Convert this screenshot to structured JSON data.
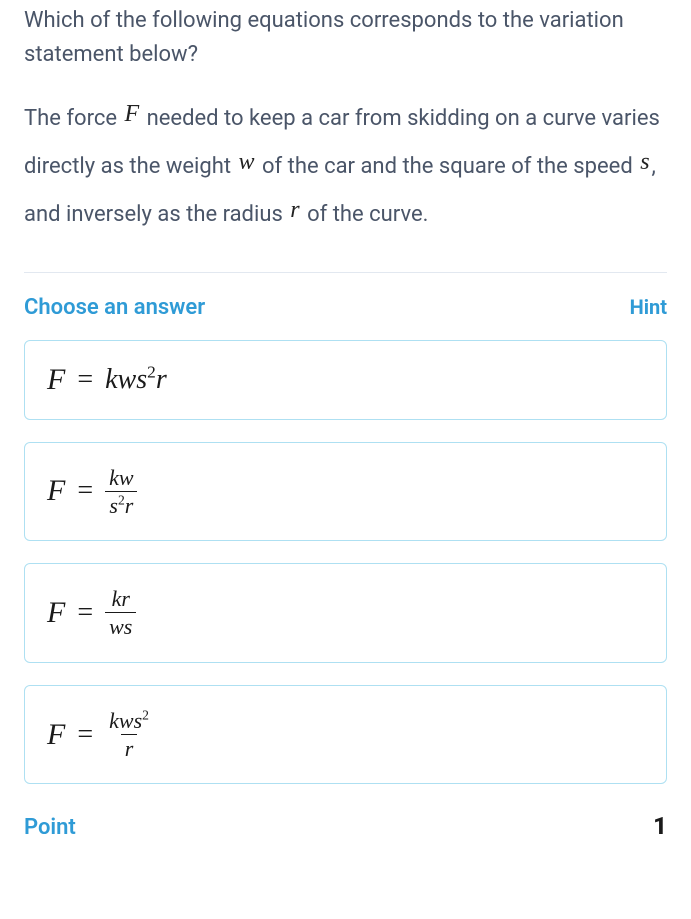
{
  "question": "Which of the following equations corresponds to the variation statement below?",
  "statement": {
    "p1a": "The force ",
    "var_F": "F",
    "p1b": " needed to keep a car from skidding on a curve varies directly as the weight ",
    "var_w": "w",
    "p1c": " of the car and the square of the speed ",
    "var_s": "s",
    "p1d": ", and inversely as the radius ",
    "var_r": "r",
    "p1e": " of the curve."
  },
  "choose_label": "Choose an answer",
  "hint_label": "Hint",
  "answers": {
    "a": {
      "lhs": "F",
      "eq": "=",
      "rhs": "kws",
      "rhs_exp": "2",
      "rhs_tail": "r"
    },
    "b": {
      "lhs": "F",
      "eq": "=",
      "num": "kw",
      "den_pre": "s",
      "den_exp": "2",
      "den_post": "r"
    },
    "c": {
      "lhs": "F",
      "eq": "=",
      "num": "kr",
      "den": "ws"
    },
    "d": {
      "lhs": "F",
      "eq": "=",
      "num_pre": "kws",
      "num_exp": "2",
      "den": "r"
    }
  },
  "point_label": "Point",
  "point_value": "1"
}
